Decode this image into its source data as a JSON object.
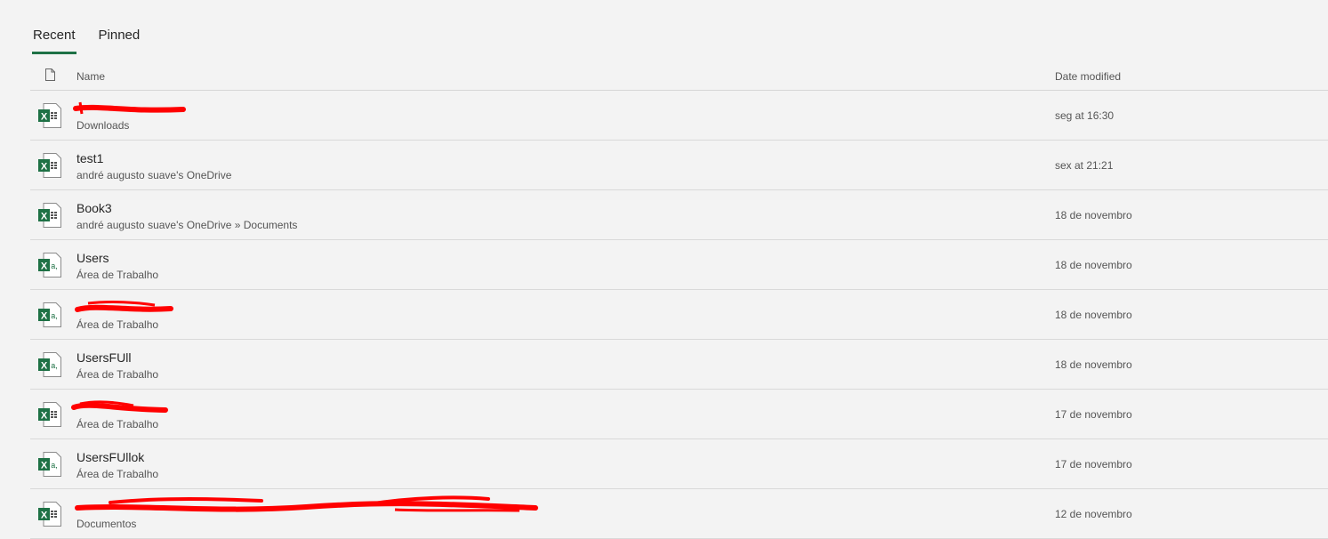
{
  "tabs": [
    {
      "label": "Recent",
      "active": true
    },
    {
      "label": "Pinned",
      "active": false
    }
  ],
  "columns": {
    "name": "Name",
    "date_modified": "Date modified"
  },
  "files": [
    {
      "name": "",
      "location": "Downloads",
      "date": "seg at 16:30",
      "icon": "excel-workbook-icon",
      "name_redacted": true
    },
    {
      "name": "test1",
      "location": "andré augusto suave's OneDrive",
      "date": "sex at 21:21",
      "icon": "excel-workbook-icon"
    },
    {
      "name": "Book3",
      "location": "andré augusto suave's OneDrive » Documents",
      "date": "18 de novembro",
      "icon": "excel-workbook-icon"
    },
    {
      "name": "Users",
      "location": "Área de Trabalho",
      "date": "18 de novembro",
      "icon": "excel-csv-icon"
    },
    {
      "name": "",
      "location": "Área de Trabalho",
      "date": "18 de novembro",
      "icon": "excel-csv-icon",
      "name_redacted": true
    },
    {
      "name": "UsersFUll",
      "location": "Área de Trabalho",
      "date": "18 de novembro",
      "icon": "excel-csv-icon"
    },
    {
      "name": "",
      "location": "Área de Trabalho",
      "date": "17 de novembro",
      "icon": "excel-workbook-icon",
      "name_redacted": true
    },
    {
      "name": "UsersFUllok",
      "location": "Área de Trabalho",
      "date": "17 de novembro",
      "icon": "excel-csv-icon"
    },
    {
      "name": "",
      "location": "Documentos",
      "date": "12 de novembro",
      "icon": "excel-workbook-icon",
      "name_redacted": true
    }
  ],
  "colors": {
    "excel_green": "#1e7145",
    "redaction_red": "#ff0000",
    "background": "#f3f3f3"
  }
}
